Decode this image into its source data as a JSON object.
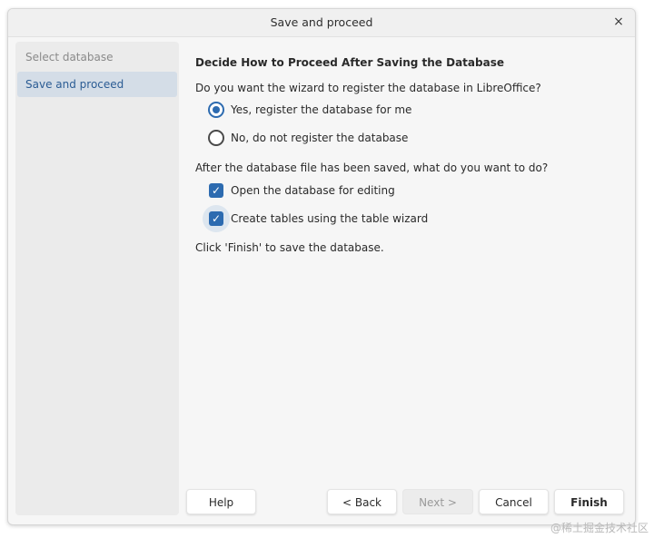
{
  "window": {
    "title": "Save and proceed",
    "close_glyph": "×"
  },
  "sidebar": {
    "items": [
      {
        "label": "Select database",
        "state": "inactive"
      },
      {
        "label": "Save and proceed",
        "state": "active"
      }
    ]
  },
  "main": {
    "heading": "Decide How to Proceed After Saving the Database",
    "register_question": "Do you want the wizard to register the database in LibreOffice?",
    "register_options": [
      {
        "label": "Yes, register the database for me",
        "selected": true
      },
      {
        "label": "No, do not register the database",
        "selected": false
      }
    ],
    "after_question": "After the database file has been saved, what do you want to do?",
    "after_options": [
      {
        "label": "Open the database for editing",
        "checked": true
      },
      {
        "label": "Create tables using the table wizard",
        "checked": true
      }
    ],
    "finish_note": "Click 'Finish' to save the database."
  },
  "buttons": {
    "help": "Help",
    "back": "< Back",
    "next": "Next >",
    "cancel": "Cancel",
    "finish": "Finish"
  },
  "icons": {
    "check_glyph": "✓"
  },
  "watermark": "@稀土掘金技术社区",
  "colors": {
    "accent": "#2d6bb0",
    "sidebar_active_bg": "#d4dde7",
    "sidebar_active_text": "#2b5c94"
  }
}
